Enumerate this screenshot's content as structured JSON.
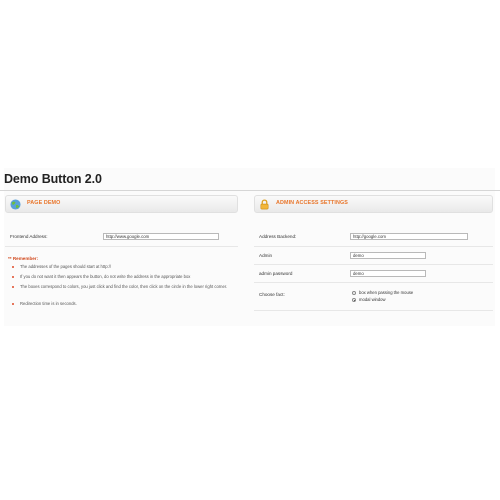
{
  "page": {
    "title": "Demo Button 2.0"
  },
  "page_demo": {
    "header": "PAGE DEMO",
    "icon": "globe-icon",
    "frontend_address": {
      "label": "Frontend Address:",
      "value": "http://www.google.com"
    },
    "remember_label": "** Remember:",
    "notes": [
      "The addresses of the pages should start at http://",
      "If you do not want it then appears the button, do not write the address in the appropriate box",
      "The boxes correspond to colors, you just click and find the color, then click on the circle in the lower right corner.",
      "Redirection time is in seconds."
    ]
  },
  "admin_access": {
    "header": "ADMIN ACCESS SETTINGS",
    "icon": "lock-icon",
    "address_backend": {
      "label": "Address Backend:",
      "value": "http://google.com"
    },
    "admin": {
      "label": "Admin",
      "value": "demo"
    },
    "admin_password": {
      "label": "admin password",
      "value": "demo"
    },
    "choose_fact": {
      "label": "Choose fact:",
      "options": [
        "box when passing the mouse",
        "modal window"
      ],
      "selected": "modal window"
    }
  },
  "colors": {
    "accent": "#e8752a",
    "remember": "#d24a1e"
  }
}
